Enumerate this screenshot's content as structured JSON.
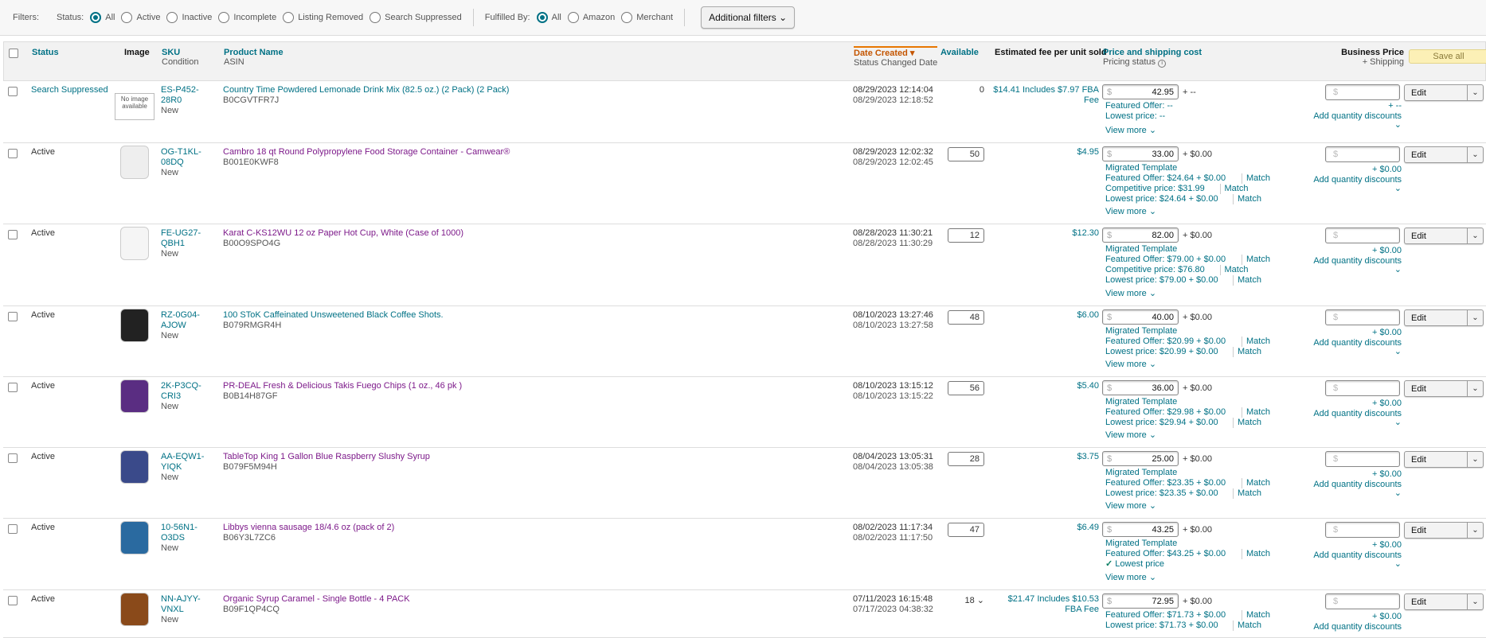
{
  "filters": {
    "label": "Filters:",
    "status_label": "Status:",
    "status_options": [
      "All",
      "Active",
      "Inactive",
      "Incomplete",
      "Listing Removed",
      "Search Suppressed"
    ],
    "fulfilled_label": "Fulfilled By:",
    "fulfilled_options": [
      "All",
      "Amazon",
      "Merchant"
    ],
    "additional": "Additional filters"
  },
  "header": {
    "status": "Status",
    "image": "Image",
    "sku": "SKU",
    "sku_sub": "Condition",
    "name": "Product Name",
    "name_sub": "ASIN",
    "date": "Date Created",
    "date_sub": "Status Changed Date",
    "available": "Available",
    "fee": "Estimated fee per unit sold",
    "price": "Price and shipping cost",
    "price_sub": "Pricing status",
    "biz": "Business Price",
    "biz_sub": "+ Shipping",
    "save_all": "Save all"
  },
  "rows": [
    {
      "status": "Search Suppressed",
      "sku": "ES-P452-28R0",
      "cond": "New",
      "name": "Country Time Powdered Lemonade Drink Mix (82.5 oz.) (2 Pack) (2 Pack)",
      "asin": "B0CGVTFR7J",
      "d1": "08/29/2023 12:14:04",
      "d2": "08/29/2023 12:18:52",
      "avail": "0",
      "fee": "$14.41 Includes $7.97 FBA Fee",
      "price": "42.95",
      "ship": "+ --",
      "l1": "Featured Offer: --",
      "l2": "Lowest price: --",
      "l3": "",
      "l4": "",
      "biz_ship": "+ --",
      "view": "View more",
      "noimg": "No image available"
    },
    {
      "status": "Active",
      "sku": "OG-T1KL-08DQ",
      "cond": "New",
      "name": "Cambro 18 qt Round Polypropylene Food Storage Container - Camwear®",
      "asin": "B001E0KWF8",
      "d1": "08/29/2023 12:02:32",
      "d2": "08/29/2023 12:02:45",
      "avail": "50",
      "fee": "$4.95",
      "price": "33.00",
      "ship": "+ $0.00",
      "l1": "Migrated Template",
      "l2": "Featured Offer: $24.64 + $0.00",
      "l3": "Competitive price: $31.99",
      "l4": "Lowest price: $24.64 + $0.00",
      "biz_ship": "+ $0.00",
      "view": "View more"
    },
    {
      "status": "Active",
      "sku": "FE-UG27-QBH1",
      "cond": "New",
      "name": "Karat C-KS12WU 12 oz Paper Hot Cup, White (Case of 1000)",
      "asin": "B00O9SPO4G",
      "d1": "08/28/2023 11:30:21",
      "d2": "08/28/2023 11:30:29",
      "avail": "12",
      "fee": "$12.30",
      "price": "82.00",
      "ship": "+ $0.00",
      "l1": "Migrated Template",
      "l2": "Featured Offer: $79.00 + $0.00",
      "l3": "Competitive price: $76.80",
      "l4": "Lowest price: $79.00 + $0.00",
      "biz_ship": "+ $0.00",
      "view": "View more"
    },
    {
      "status": "Active",
      "sku": "RZ-0G04-AJOW",
      "cond": "New",
      "name": "100 SToK Caffeinated Unsweetened Black Coffee Shots.",
      "asin": "B079RMGR4H",
      "d1": "08/10/2023 13:27:46",
      "d2": "08/10/2023 13:27:58",
      "avail": "48",
      "fee": "$6.00",
      "price": "40.00",
      "ship": "+ $0.00",
      "l1": "Migrated Template",
      "l2": "Featured Offer: $20.99 + $0.00",
      "l3": "Lowest price: $20.99 + $0.00",
      "l4": "",
      "biz_ship": "+ $0.00",
      "view": "View more"
    },
    {
      "status": "Active",
      "sku": "2K-P3CQ-CRI3",
      "cond": "New",
      "name": "PR-DEAL Fresh & Delicious Takis Fuego Chips (1 oz., 46 pk )",
      "asin": "B0B14H87GF",
      "d1": "08/10/2023 13:15:12",
      "d2": "08/10/2023 13:15:22",
      "avail": "56",
      "fee": "$5.40",
      "price": "36.00",
      "ship": "+ $0.00",
      "l1": "Migrated Template",
      "l2": "Featured Offer: $29.98 + $0.00",
      "l3": "Lowest price: $29.94 + $0.00",
      "l4": "",
      "biz_ship": "+ $0.00",
      "view": "View more"
    },
    {
      "status": "Active",
      "sku": "AA-EQW1-YIQK",
      "cond": "New",
      "name": "TableTop King 1 Gallon Blue Raspberry Slushy Syrup",
      "asin": "B079F5M94H",
      "d1": "08/04/2023 13:05:31",
      "d2": "08/04/2023 13:05:38",
      "avail": "28",
      "fee": "$3.75",
      "price": "25.00",
      "ship": "+ $0.00",
      "l1": "Migrated Template",
      "l2": "Featured Offer: $23.35 + $0.00",
      "l3": "Lowest price: $23.35 + $0.00",
      "l4": "",
      "biz_ship": "+ $0.00",
      "view": "View more"
    },
    {
      "status": "Active",
      "sku": "10-56N1-O3DS",
      "cond": "New",
      "name": "Libbys vienna sausage 18/4.6 oz (pack of 2)",
      "asin": "B06Y3L7ZC6",
      "d1": "08/02/2023 11:17:34",
      "d2": "08/02/2023 11:17:50",
      "avail": "47",
      "fee": "$6.49",
      "price": "43.25",
      "ship": "+ $0.00",
      "l1": "Migrated Template",
      "l2": "Featured Offer: $43.25 + $0.00",
      "l3": "Lowest price",
      "l4": "",
      "biz_ship": "+ $0.00",
      "view": "View more"
    },
    {
      "status": "Active",
      "sku": "NN-AJYY-VNXL",
      "cond": "New",
      "name": "Organic Syrup Caramel - Single Bottle - 4 PACK",
      "asin": "B09F1QP4CQ",
      "d1": "07/11/2023 16:15:48",
      "d2": "07/17/2023 04:38:32",
      "avail": "18",
      "fee": "$21.47 Includes $10.53 FBA Fee",
      "price": "72.95",
      "ship": "+ $0.00",
      "l1": "Featured Offer: $71.73 + $0.00",
      "l2": "Lowest price: $71.73 + $0.00",
      "l3": "",
      "l4": "",
      "biz_ship": "+ $0.00",
      "view": ""
    }
  ],
  "common": {
    "match": "Match",
    "edit": "Edit",
    "add_qty": "Add quantity discounts",
    "dollar": "$"
  }
}
